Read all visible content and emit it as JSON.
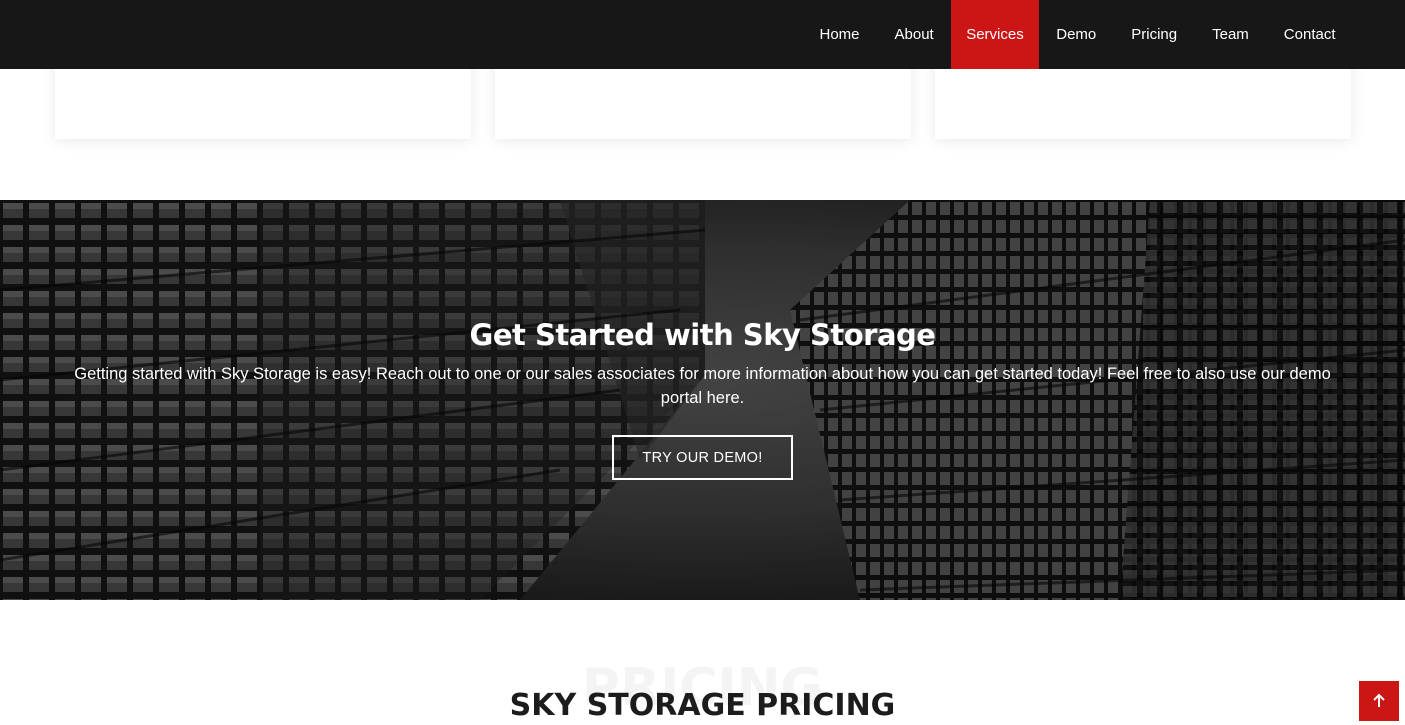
{
  "nav": {
    "items": [
      {
        "label": "Home"
      },
      {
        "label": "About"
      },
      {
        "label": "Services"
      },
      {
        "label": "Demo"
      },
      {
        "label": "Pricing"
      },
      {
        "label": "Team"
      },
      {
        "label": "Contact"
      }
    ],
    "active": "Services"
  },
  "cta": {
    "title": "Get Started with Sky Storage",
    "text": "Getting started with Sky Storage is easy! Reach out to one or our sales associates for more information about how you can get started today! Feel free to also use our demo portal here.",
    "button_label": "TRY OUR DEMO!"
  },
  "pricing": {
    "background_title": "PRICING",
    "title": "SKY STORAGE PRICING"
  },
  "back_to_top": {
    "icon": "arrow-up-icon"
  },
  "colors": {
    "accent": "#cc1616",
    "navbar": "#171717"
  }
}
